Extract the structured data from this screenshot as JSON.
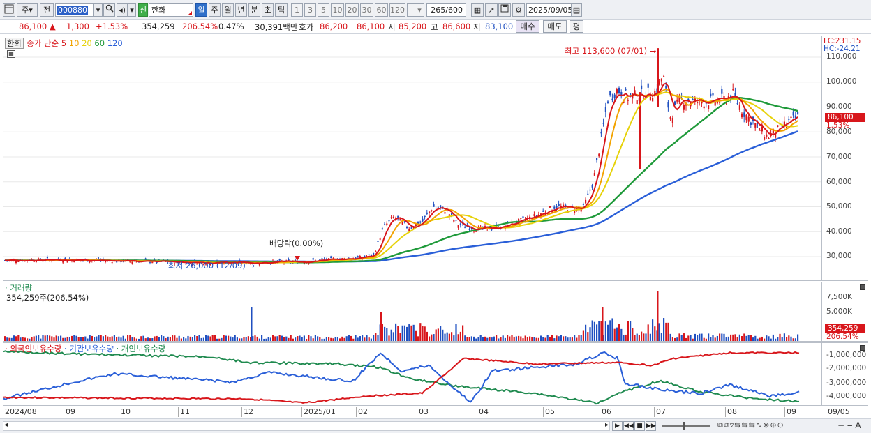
{
  "toolbar": {
    "period_label": "주",
    "view_label": "전",
    "stock_code": "000880",
    "shin_label": "신",
    "stock_name": "한화",
    "intervals": [
      "일",
      "주",
      "월",
      "년",
      "분",
      "초",
      "틱"
    ],
    "selected_interval": "일",
    "counts": [
      "1",
      "3",
      "5",
      "10",
      "20",
      "30",
      "60",
      "120"
    ],
    "view_count": "265",
    "view_total": "/600",
    "date": "2025/09/05"
  },
  "quote": {
    "price": "86,100",
    "change": "1,300",
    "change_pct": "+1.53%",
    "volume": "354,259",
    "volume_ratio": "206.54%",
    "turnover_pct": "0.47%",
    "trade_value": "30,391백만",
    "bid_label": "호가",
    "bid1": "86,200",
    "bid2": "86,100",
    "open_label": "시",
    "open": "85,200",
    "high_label": "고",
    "high": "86,600",
    "low_label": "저",
    "low": "83,100",
    "buy_label": "매수",
    "sell_label": "매도",
    "avg_label": "평"
  },
  "price_panel": {
    "legend_name": "한화",
    "legend_title": "종가 단순",
    "ma_periods": [
      "5",
      "10",
      "20",
      "60",
      "120"
    ],
    "ma_colors": [
      "#d8161b",
      "#f2a300",
      "#e6d20a",
      "#1f9a3a",
      "#2a5fd8"
    ],
    "high_annotation": "최고 113,600 (07/01)",
    "low_annotation": "최저 26,000 (12/09)",
    "dividend_annotation": "배당락(0.00%)",
    "lc": "LC:231.15",
    "hc": "HC:-24.21",
    "current_tag": "86,100",
    "current_pct": "1.53%",
    "y_ticks": [
      "110,000",
      "100,000",
      "90,000",
      "80,000",
      "70,000",
      "60,000",
      "50,000",
      "40,000",
      "30,000"
    ]
  },
  "volume_panel": {
    "title": "거래량",
    "value": "354,259주(206.54%)",
    "y_ticks": [
      "7,500K",
      "5,000K"
    ],
    "current_tag": "354,259",
    "current_pct": "206.54%"
  },
  "holdings_panel": {
    "series": [
      "외국인보유수량",
      "기관보유수량",
      "개인보유수량"
    ],
    "colors": [
      "#d8161b",
      "#2a5fd8",
      "#1f8a4f"
    ],
    "y_ticks": [
      "-1,000,000",
      "-2,000,000",
      "-3,000,000",
      "-4,000,000"
    ]
  },
  "dates": [
    "2024/08",
    "09",
    "10",
    "11",
    "12",
    "2025/01",
    "02",
    "03",
    "04",
    "05",
    "06",
    "07",
    "08",
    "09"
  ],
  "last_date": "09/05"
}
